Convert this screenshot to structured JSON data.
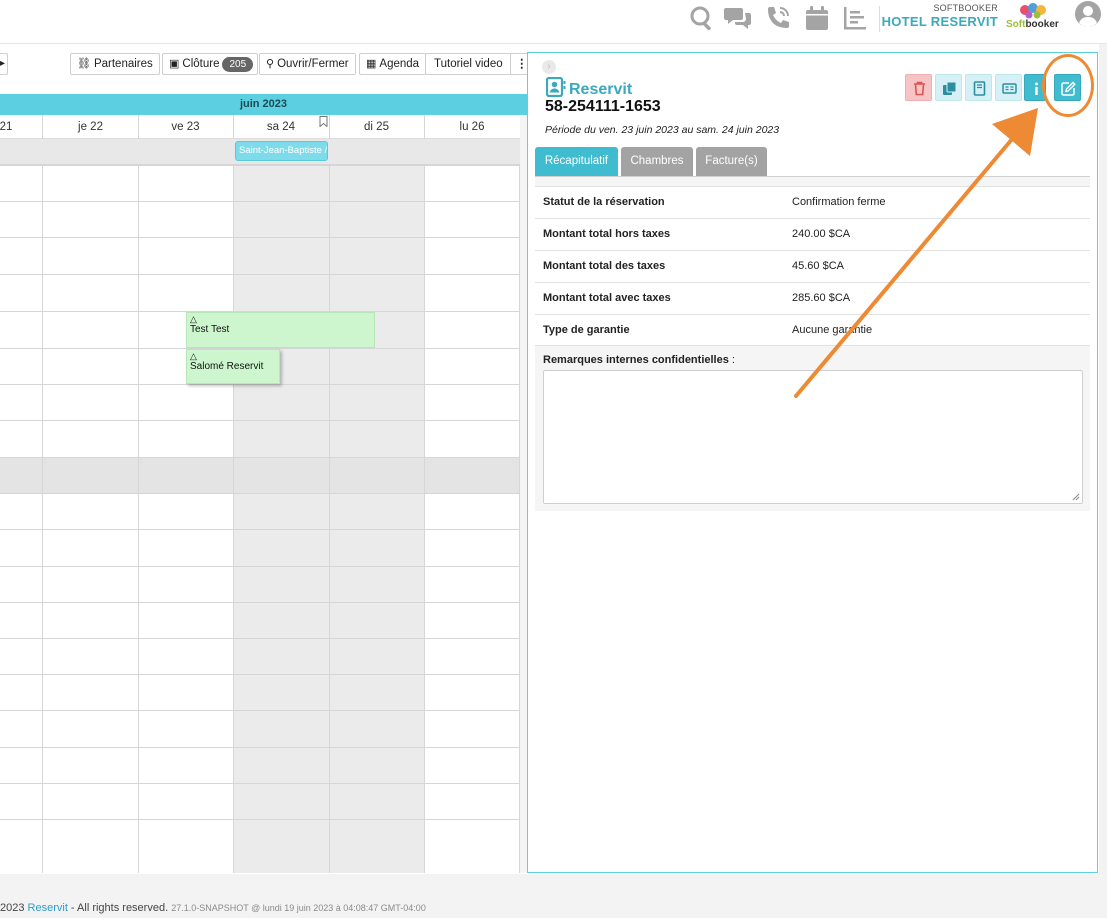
{
  "header": {
    "brand_small": "SOFTBOOKER",
    "hotel_name": "HOTEL RESERVIT",
    "logo_soft": "Soft",
    "logo_booker": "booker",
    "icons": [
      "search-icon",
      "chat-icon",
      "phone-icon",
      "calendar-icon",
      "report-icon",
      "user-avatar-icon"
    ]
  },
  "toolbar": {
    "partenaires": "Partenaires",
    "cloture": "Clôture",
    "cloture_count": "205",
    "ouvrir_fermer": "Ouvrir/Fermer",
    "agenda": "Agenda",
    "tutoriel": "Tutoriel video",
    "more": "⋮"
  },
  "calendar": {
    "month": "juin 2023",
    "days": [
      "21",
      "je 22",
      "ve 23",
      "sa 24",
      "di 25",
      "lu 26"
    ],
    "holiday": "Saint-Jean-Baptiste / ",
    "bookings": [
      {
        "name": "Test Test"
      },
      {
        "name": "Salomé Reservit"
      }
    ]
  },
  "panel": {
    "title": "Reservit",
    "number": "58-254111-1653",
    "period": "Période du ven. 23 juin 2023 au sam. 24 juin 2023",
    "tabs": [
      "Récapitulatif",
      "Chambres",
      "Facture(s)"
    ],
    "rows": [
      {
        "label": "Statut de la réservation",
        "value": "Confirmation ferme"
      },
      {
        "label": "Montant total hors taxes",
        "value": "240.00 $CA"
      },
      {
        "label": "Montant total des taxes",
        "value": "45.60 $CA"
      },
      {
        "label": "Montant total avec taxes",
        "value": "285.60 $CA"
      },
      {
        "label": "Type de garantie",
        "value": "Aucune garantie"
      }
    ],
    "remarks_label": "Remarques internes confidentielles",
    "remarks_suffix": " :",
    "remarks_value": "",
    "actions": [
      "trash-icon",
      "duplicate-icon",
      "book-icon",
      "id-card-icon",
      "info-icon",
      "edit-icon"
    ],
    "colors": {
      "accent": "#3fbcd0",
      "danger": "#e05252",
      "annotation": "#ee8a33"
    }
  },
  "footer": {
    "prefix": "2023 ",
    "link": "Reservit",
    "rights": " - All rights reserved. ",
    "version": "27.1.0-SNAPSHOT @ lundi 19 juin 2023 à 04:08:47 GMT-04:00"
  }
}
